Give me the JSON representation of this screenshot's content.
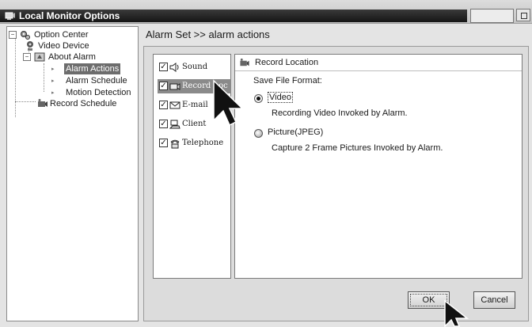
{
  "window": {
    "title": "Local Monitor Options"
  },
  "tree": {
    "root": "Option Center",
    "video_device": "Video Device",
    "about_alarm": "About Alarm",
    "alarm_actions": "Alarm Actions",
    "alarm_schedule": "Alarm Schedule",
    "motion_detection": "Motion Detection",
    "record_schedule": "Record Schedule",
    "selected": "Alarm Actions"
  },
  "breadcrumb": "Alarm Set >> alarm actions",
  "actions": [
    {
      "label": "Sound",
      "checked": true,
      "icon": "speaker-icon"
    },
    {
      "label": "Record Loca",
      "checked": true,
      "icon": "camera-icon",
      "selected": true
    },
    {
      "label": "E-mail",
      "checked": true,
      "icon": "envelope-icon"
    },
    {
      "label": "Client",
      "checked": true,
      "icon": "client-icon"
    },
    {
      "label": "Telephone",
      "checked": true,
      "icon": "telephone-icon"
    }
  ],
  "detail": {
    "header": "Record Location",
    "format_label": "Save File Format:",
    "option_video": "Video",
    "option_video_desc": "Recording Video Invoked by Alarm.",
    "option_picture": "Picture(JPEG)",
    "option_picture_desc": "Capture 2 Frame Pictures Invoked by Alarm.",
    "selected_format": "Video"
  },
  "buttons": {
    "ok": "OK",
    "cancel": "Cancel"
  }
}
